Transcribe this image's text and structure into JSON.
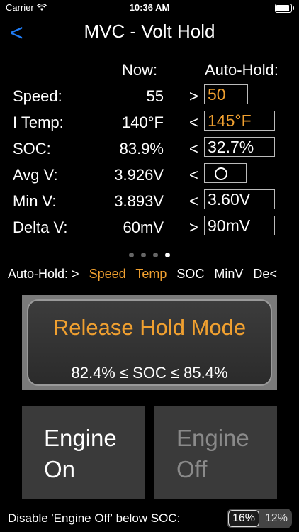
{
  "status_bar": {
    "carrier": "Carrier",
    "time": "10:36 AM",
    "battery_level": 1.0
  },
  "nav": {
    "back_label": "<",
    "title": "MVC - Volt Hold"
  },
  "columns": {
    "now": "Now:",
    "auto_hold": "Auto-Hold:"
  },
  "rows": [
    {
      "label": "Speed:",
      "now": "55",
      "op": ">",
      "value": "50",
      "highlight": true
    },
    {
      "label": "I Temp:",
      "now": "140°F",
      "op": "<",
      "value": "145°F",
      "highlight": true
    },
    {
      "label": "SOC:",
      "now": "83.9%",
      "op": "<",
      "value": "32.7%",
      "highlight": false
    },
    {
      "label": "Avg V:",
      "now": "3.926V",
      "op": "<",
      "value": "",
      "highlight": false
    },
    {
      "label": "Min V:",
      "now": "3.893V",
      "op": "<",
      "value": "3.60V",
      "highlight": false
    },
    {
      "label": "Delta V:",
      "now": "60mV",
      "op": ">",
      "value": "90mV",
      "highlight": false
    }
  ],
  "page_dots": {
    "count": 4,
    "active": 3
  },
  "auto_hold_bar": {
    "prefix": "Auto-Hold: >",
    "items": [
      {
        "label": "Speed",
        "active": true
      },
      {
        "label": "Temp",
        "active": true
      },
      {
        "label": "SOC",
        "active": false
      },
      {
        "label": "MinV",
        "active": false
      },
      {
        "label": "De",
        "active": false
      }
    ],
    "suffix": "<"
  },
  "release": {
    "title": "Release Hold Mode",
    "range": "82.4%  ≤  SOC  ≤  85.4%"
  },
  "engine_on": {
    "line1": "Engine",
    "line2": "On"
  },
  "engine_off": {
    "line1": "Engine",
    "line2": "Off"
  },
  "footer": {
    "label": "Disable 'Engine Off' below SOC:",
    "options": [
      "16%",
      "12%"
    ],
    "selected": "16%"
  },
  "colors": {
    "accent_orange": "#f0a030",
    "link_blue": "#1f7cf5"
  }
}
